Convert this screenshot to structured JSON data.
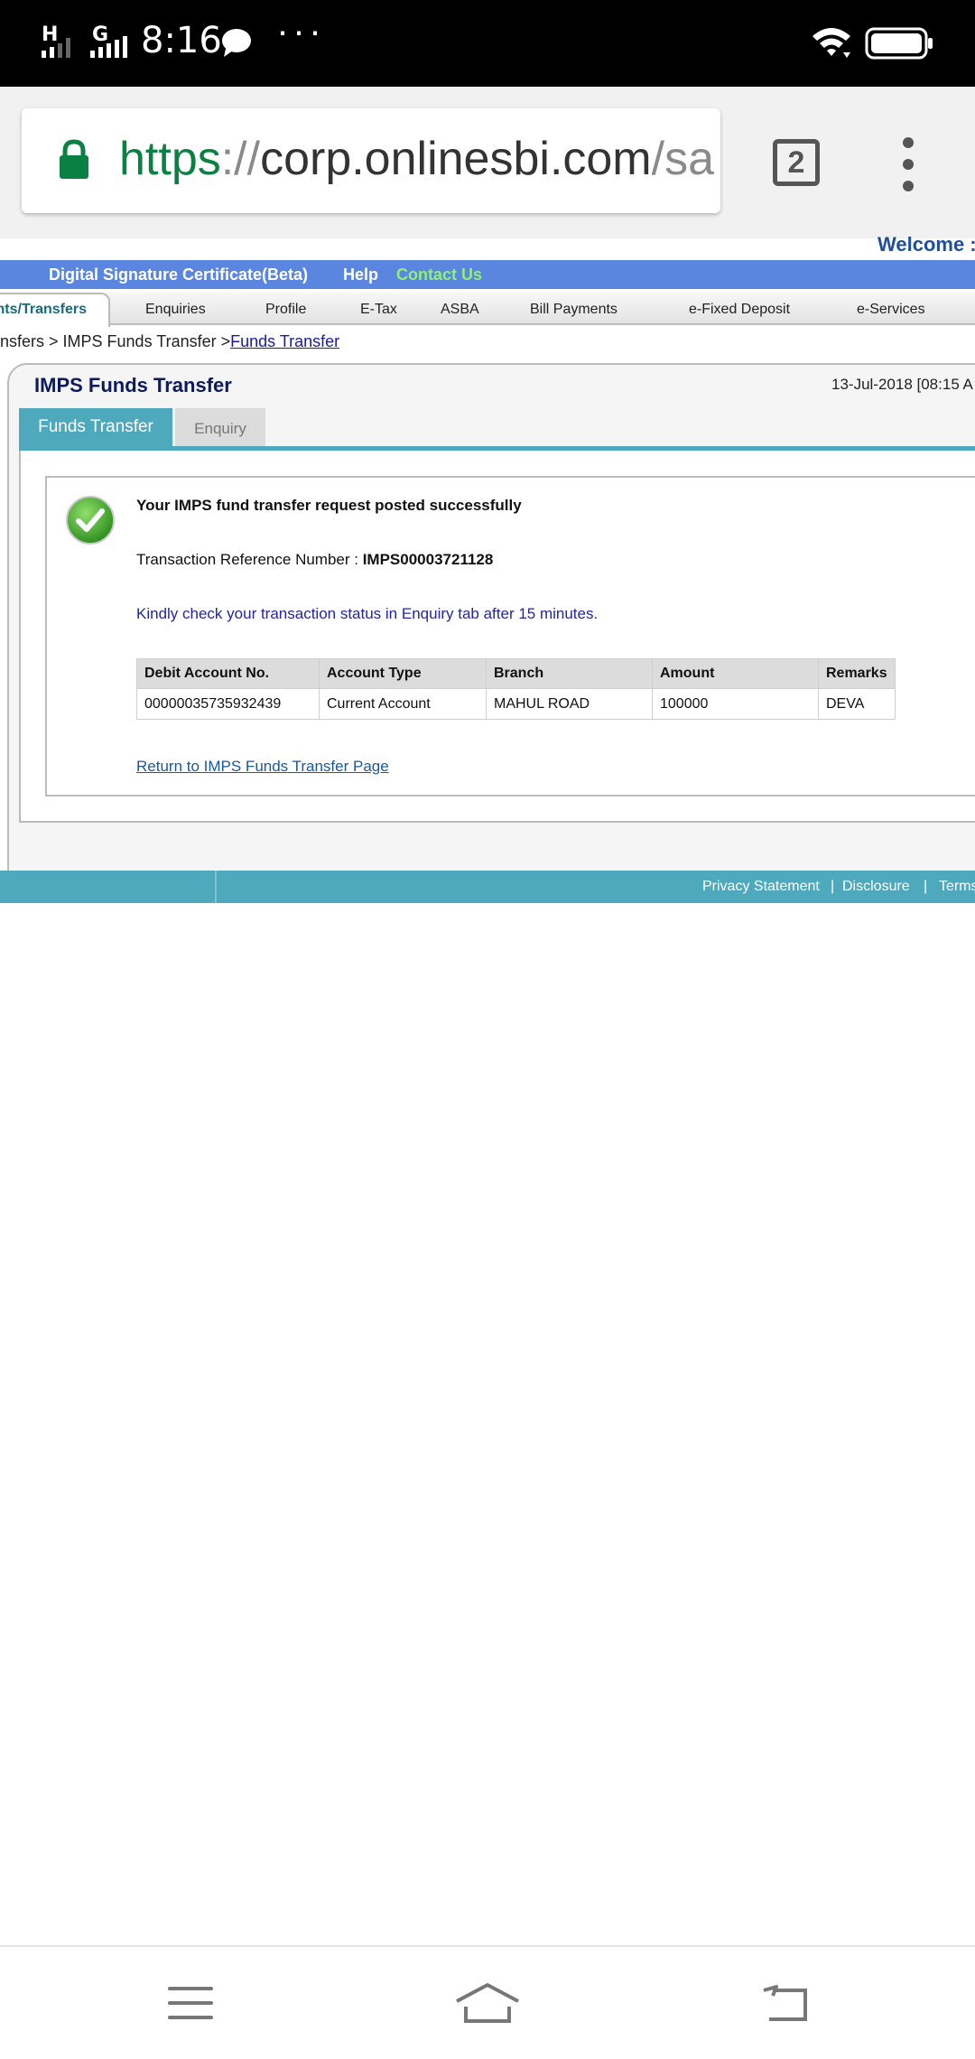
{
  "status_bar": {
    "time": "8:16",
    "signal1_label": "H",
    "signal2_label": "G",
    "more": "···"
  },
  "browser": {
    "url_scheme": "https",
    "url_sep": "://",
    "url_host": "corp.onlinesbi.com",
    "url_path": "/sa",
    "tab_count": "2"
  },
  "header": {
    "welcome": "Welcome :",
    "links": {
      "dsc": "Digital Signature Certificate(Beta)",
      "help": "Help",
      "contact": "Contact Us"
    }
  },
  "nav": {
    "active": "nts/Transfers",
    "items": [
      "Enquiries",
      "Profile",
      "E-Tax",
      "ASBA",
      "Bill Payments",
      "e-Fixed Deposit",
      "e-Services"
    ]
  },
  "breadcrumb": {
    "prefix": "nsfers > IMPS Funds Transfer >",
    "link": "Funds Transfer"
  },
  "panel": {
    "title": "IMPS Funds Transfer",
    "date": "13-Jul-2018 [08:15 A",
    "tabs": {
      "funds_transfer": "Funds Transfer",
      "enquiry": "Enquiry"
    }
  },
  "result": {
    "success_message": "Your IMPS fund transfer request posted successfully",
    "ref_label": "Transaction Reference Number : ",
    "ref_value": "IMPS00003721128",
    "info": "Kindly check your transaction status in Enquiry tab after 15 minutes.",
    "table": {
      "headers": [
        "Debit Account No.",
        "Account Type",
        "Branch",
        "Amount",
        "Remarks"
      ],
      "rows": [
        [
          "00000035735932439",
          "Current Account",
          "MAHUL ROAD",
          "100000",
          "DEVA"
        ]
      ]
    },
    "return_link": "Return to IMPS Funds Transfer Page"
  },
  "footer": {
    "privacy": "Privacy Statement",
    "sep": "|",
    "disclosure": "Disclosure",
    "terms": "Terms"
  },
  "colors": {
    "accent_teal": "#4fa9bd",
    "header_blue": "#5b86e0",
    "contact_green": "#8ef07a",
    "link_blue": "#1a5a9c"
  }
}
